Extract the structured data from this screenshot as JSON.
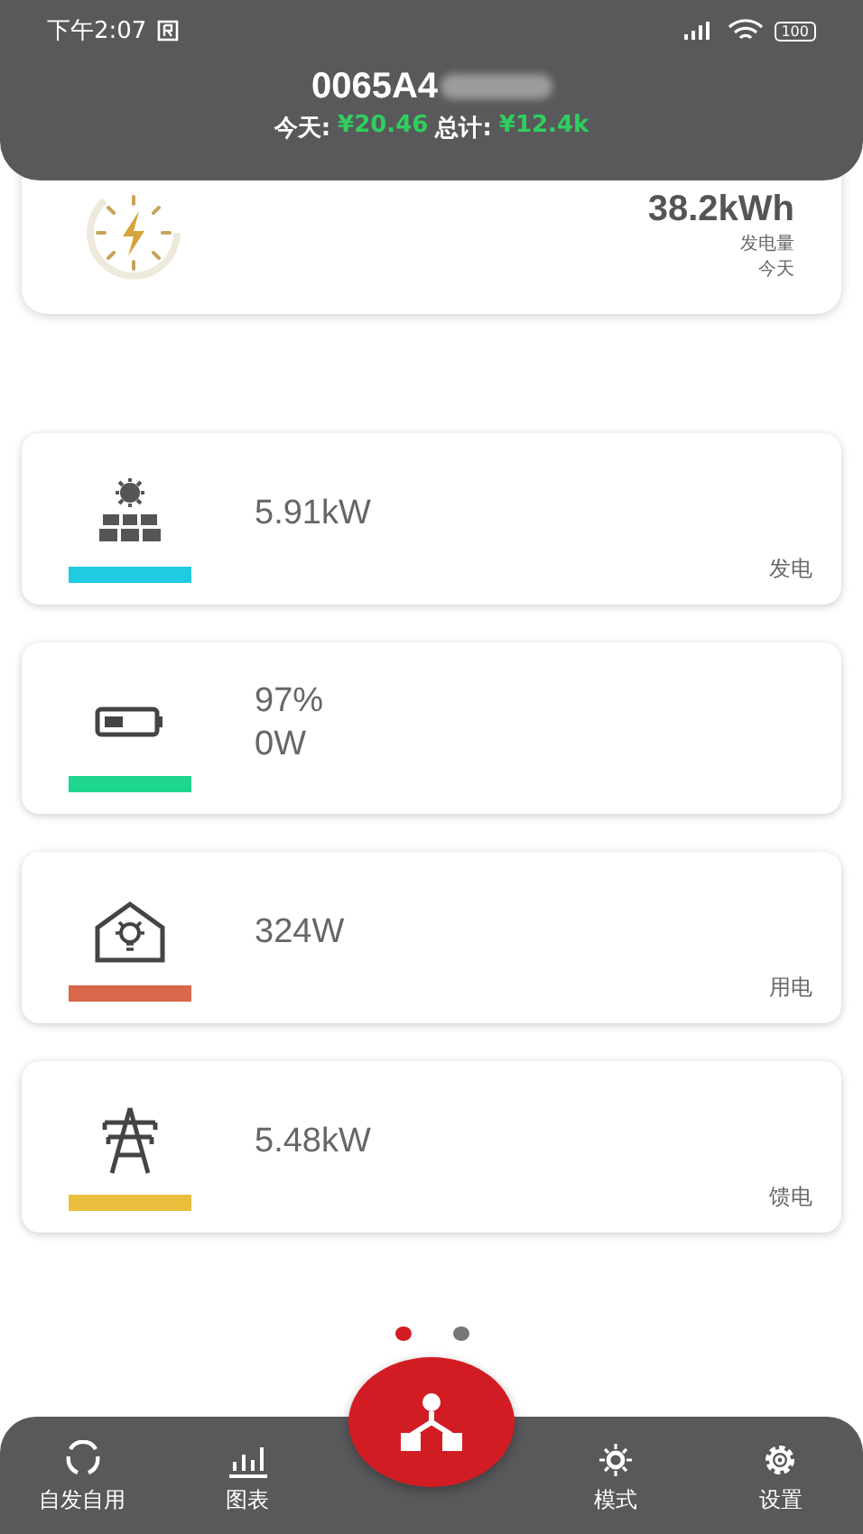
{
  "status_bar": {
    "time": "下午2:07",
    "battery": "100"
  },
  "header": {
    "serial": "0065A4",
    "today_label": "今天:",
    "today_value": "¥20.46",
    "total_label": "总计:",
    "total_value": "¥12.4k"
  },
  "summary": {
    "value": "38.2kWh",
    "label": "发电量",
    "period": "今天"
  },
  "cards": [
    {
      "kind": "solar",
      "lines": [
        "5.91kW"
      ],
      "label": "发电",
      "color": "#1fcbe0"
    },
    {
      "kind": "battery",
      "lines": [
        "97%",
        "0W"
      ],
      "color": "#1fd690"
    },
    {
      "kind": "home",
      "lines": [
        "324W"
      ],
      "label": "用电",
      "color": "#d9674a"
    },
    {
      "kind": "grid",
      "lines": [
        "5.48kW"
      ],
      "label": "馈电",
      "color": "#e8be3c"
    }
  ],
  "page_dots": [
    {
      "selected": true
    },
    {
      "selected": false
    }
  ],
  "nav": [
    {
      "kind": "cycle",
      "label": "自发自用",
      "selected": false
    },
    {
      "kind": "chart",
      "label": "图表",
      "selected": false
    },
    {
      "kind": "flow",
      "selected": true
    },
    {
      "kind": "mode",
      "label": "模式",
      "selected": false
    },
    {
      "kind": "settings",
      "label": "设置",
      "selected": false
    }
  ]
}
